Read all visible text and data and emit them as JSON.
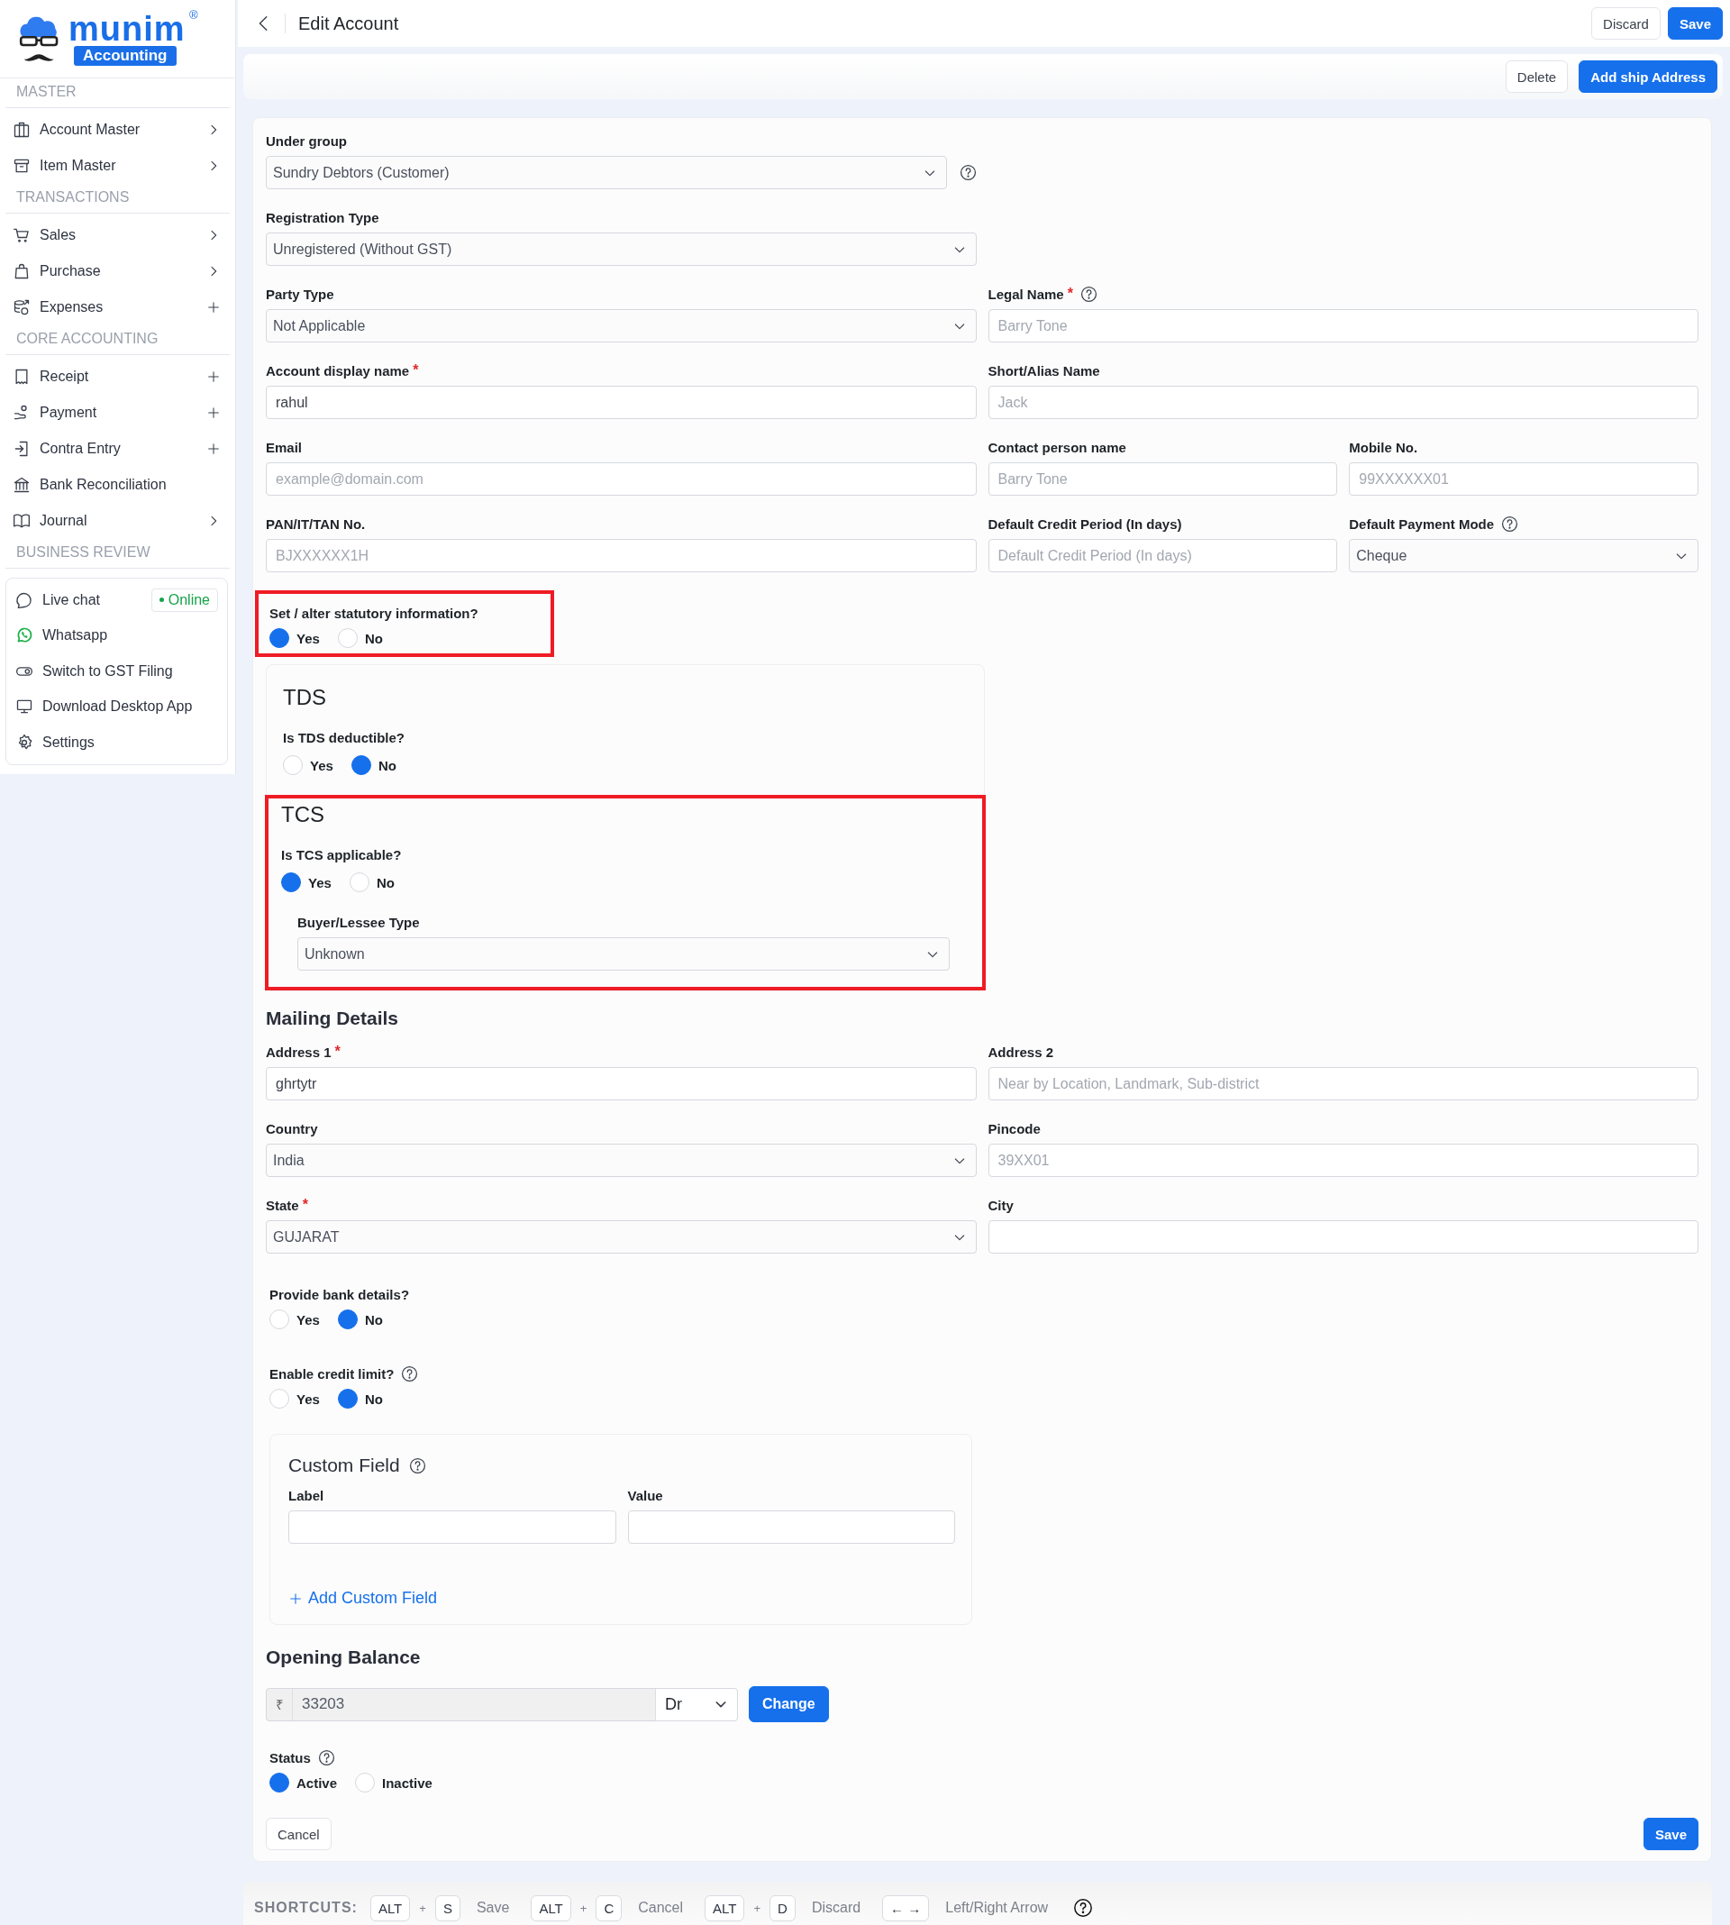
{
  "sidebar": {
    "logo": {
      "name": "munim",
      "badge": "Accounting",
      "trademark": "®"
    },
    "sections": [
      {
        "title": "MASTER",
        "items": [
          {
            "label": "Account Master",
            "chevron": true
          },
          {
            "label": "Item Master",
            "chevron": true
          }
        ]
      },
      {
        "title": "TRANSACTIONS",
        "items": [
          {
            "label": "Sales",
            "chevron": true
          },
          {
            "label": "Purchase",
            "chevron": true
          },
          {
            "label": "Expenses",
            "add": true
          }
        ]
      },
      {
        "title": "CORE ACCOUNTING",
        "items": [
          {
            "label": "Receipt",
            "add": true
          },
          {
            "label": "Payment",
            "add": true
          },
          {
            "label": "Contra Entry",
            "add": true
          },
          {
            "label": "Bank Reconciliation"
          },
          {
            "label": "Journal",
            "chevron": true
          }
        ]
      },
      {
        "title": "BUSINESS REVIEW"
      }
    ],
    "help_panel": [
      {
        "label": "Live chat",
        "badge": "Online"
      },
      {
        "label": "Whatsapp"
      },
      {
        "label": "Switch to GST Filing"
      },
      {
        "label": "Download Desktop App"
      },
      {
        "label": "Settings"
      }
    ]
  },
  "header": {
    "title": "Edit Account",
    "buttons": [
      {
        "label": "Discard",
        "kind": "secondary"
      },
      {
        "label": "Save",
        "kind": "primary"
      }
    ]
  },
  "action_bar": {
    "buttons": [
      {
        "label": "Delete",
        "kind": "secondary"
      },
      {
        "label": "Add ship Address",
        "kind": "primary"
      }
    ]
  },
  "form": {
    "items": [
      {
        "kind": "fields",
        "fields": [
          {
            "kind": "select",
            "label": "Under group",
            "value": "Sundry Debtors (Customer)",
            "help_after_field": true
          }
        ]
      },
      {
        "kind": "fields",
        "fields": [
          {
            "kind": "select",
            "label": "Registration Type",
            "value": "Unregistered (Without GST)"
          }
        ]
      },
      {
        "kind": "fields",
        "fields": [
          {
            "kind": "select",
            "label": "Party Type",
            "value": "Not Applicable"
          },
          {
            "kind": "text",
            "label": "Legal Name",
            "required_mark": "*",
            "help": true,
            "placeholder": "Barry Tone"
          }
        ]
      },
      {
        "kind": "fields",
        "fields": [
          {
            "kind": "text",
            "label": "Account display name",
            "required_mark": "*",
            "value": "rahul"
          },
          {
            "kind": "text",
            "label": "Short/Alias Name",
            "placeholder": "Jack"
          }
        ]
      },
      {
        "kind": "fields",
        "fields": [
          {
            "kind": "text",
            "label": "Email",
            "placeholder": "example@domain.com"
          },
          {
            "kind": "text",
            "label": "Contact person name",
            "placeholder": "Barry Tone"
          },
          {
            "kind": "text",
            "label": "Mobile No.",
            "placeholder": "99XXXXXX01"
          }
        ]
      },
      {
        "kind": "fields",
        "fields": [
          {
            "kind": "text",
            "label": "PAN/IT/TAN No.",
            "placeholder": "BJXXXXXX1H"
          },
          {
            "kind": "text",
            "label": "Default Credit Period (In days)",
            "placeholder": "Default Credit Period (In days)"
          },
          {
            "kind": "select",
            "label": "Default Payment Mode",
            "help": true,
            "value": "Cheque"
          }
        ]
      },
      {
        "kind": "radio",
        "label": "Set / alter statutory information?",
        "highlighted": true,
        "options": [
          {
            "label": "Yes",
            "selected": true
          },
          {
            "label": "No",
            "selected": false
          }
        ]
      },
      {
        "kind": "statutory",
        "sections": [
          {
            "title": "TDS",
            "highlighted": false,
            "question": {
              "label": "Is TDS deductible?",
              "options": [
                {
                  "label": "Yes",
                  "selected": false
                },
                {
                  "label": "No",
                  "selected": true
                }
              ]
            }
          },
          {
            "title": "TCS",
            "highlighted": true,
            "question": {
              "label": "Is TCS applicable?",
              "options": [
                {
                  "label": "Yes",
                  "selected": true
                },
                {
                  "label": "No",
                  "selected": false
                }
              ]
            },
            "select": {
              "label": "Buyer/Lessee Type",
              "value": "Unknown"
            }
          }
        ]
      },
      {
        "kind": "heading",
        "text": "Mailing Details"
      },
      {
        "kind": "fields",
        "fields": [
          {
            "kind": "text",
            "label": "Address 1",
            "required_mark": "*",
            "value": "ghrtytr"
          },
          {
            "kind": "text",
            "label": "Address 2",
            "placeholder": "Near by Location, Landmark, Sub-district"
          }
        ]
      },
      {
        "kind": "fields",
        "fields": [
          {
            "kind": "select",
            "label": "Country",
            "value": "India"
          },
          {
            "kind": "text",
            "label": "Pincode",
            "placeholder": "39XX01"
          }
        ]
      },
      {
        "kind": "fields",
        "fields": [
          {
            "kind": "select",
            "label": "State",
            "required_mark": "*",
            "value": "GUJARAT"
          },
          {
            "kind": "text",
            "label": "City"
          }
        ]
      },
      {
        "kind": "radio",
        "label": "Provide bank details?",
        "highlighted": false,
        "options": [
          {
            "label": "Yes",
            "selected": false
          },
          {
            "label": "No",
            "selected": true
          }
        ]
      },
      {
        "kind": "radio",
        "label": "Enable credit limit?",
        "help": true,
        "highlighted": false,
        "options": [
          {
            "label": "Yes",
            "selected": false
          },
          {
            "label": "No",
            "selected": true
          }
        ]
      },
      {
        "kind": "custom_fields",
        "title": "Custom Field",
        "help": true,
        "columns": [
          "Label",
          "Value"
        ],
        "add_link": "Add Custom Field"
      },
      {
        "kind": "opening_balance",
        "title": "Opening Balance",
        "currency": "₹",
        "value": "33203",
        "type": "Dr",
        "button": "Change"
      },
      {
        "kind": "radio",
        "label": "Status",
        "help": true,
        "highlighted": false,
        "options": [
          {
            "label": "Active",
            "selected": true
          },
          {
            "label": "Inactive",
            "selected": false
          }
        ]
      }
    ],
    "buttons": [
      {
        "label": "Cancel",
        "kind": "secondary"
      },
      {
        "label": "Save",
        "kind": "primary"
      }
    ]
  },
  "footer": {
    "label": "SHORTCUTS:",
    "separator": "+",
    "help": true,
    "items": [
      {
        "keys": [
          "ALT",
          "S"
        ],
        "action": "Save"
      },
      {
        "keys": [
          "ALT",
          "C"
        ],
        "action": "Cancel"
      },
      {
        "keys": [
          "ALT",
          "D"
        ],
        "action": "Discard"
      },
      {
        "keys": [
          "← →"
        ],
        "action": "Left/Right Arrow"
      }
    ]
  }
}
